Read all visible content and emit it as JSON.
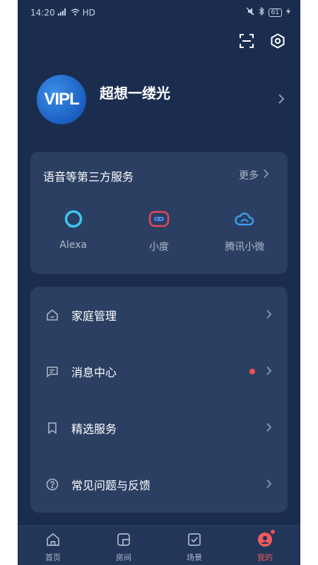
{
  "status_bar": {
    "time": "14:20",
    "network": "HD",
    "battery": "61"
  },
  "top_actions": {
    "scan_icon": "scan-icon",
    "settings_icon": "gear-icon"
  },
  "profile": {
    "avatar_text": "VIPL",
    "username": "超想一缕光"
  },
  "voice_services": {
    "title": "语音等第三方服务",
    "more_label": "更多",
    "items": [
      {
        "label": "Alexa",
        "icon": "alexa-icon",
        "color": "#3ec6f0"
      },
      {
        "label": "小度",
        "icon": "xiaodu-icon",
        "color": "#e0485a"
      },
      {
        "label": "腾讯小微",
        "icon": "tencent-xiaowei-icon",
        "color": "#3a9ef0"
      }
    ]
  },
  "menu": {
    "items": [
      {
        "label": "家庭管理",
        "icon": "home-icon"
      },
      {
        "label": "消息中心",
        "icon": "message-icon",
        "has_dot": true
      },
      {
        "label": "精选服务",
        "icon": "bookmark-icon"
      },
      {
        "label": "常见问题与反馈",
        "icon": "help-icon"
      }
    ]
  },
  "bottom_nav": {
    "items": [
      {
        "label": "首页",
        "icon": "home-icon"
      },
      {
        "label": "房间",
        "icon": "room-icon"
      },
      {
        "label": "场景",
        "icon": "scene-icon"
      },
      {
        "label": "我的",
        "icon": "profile-icon",
        "active": true
      }
    ]
  },
  "colors": {
    "background": "#1b2d4f",
    "card": "#2b3f62",
    "accent_red": "#f05a5a"
  }
}
